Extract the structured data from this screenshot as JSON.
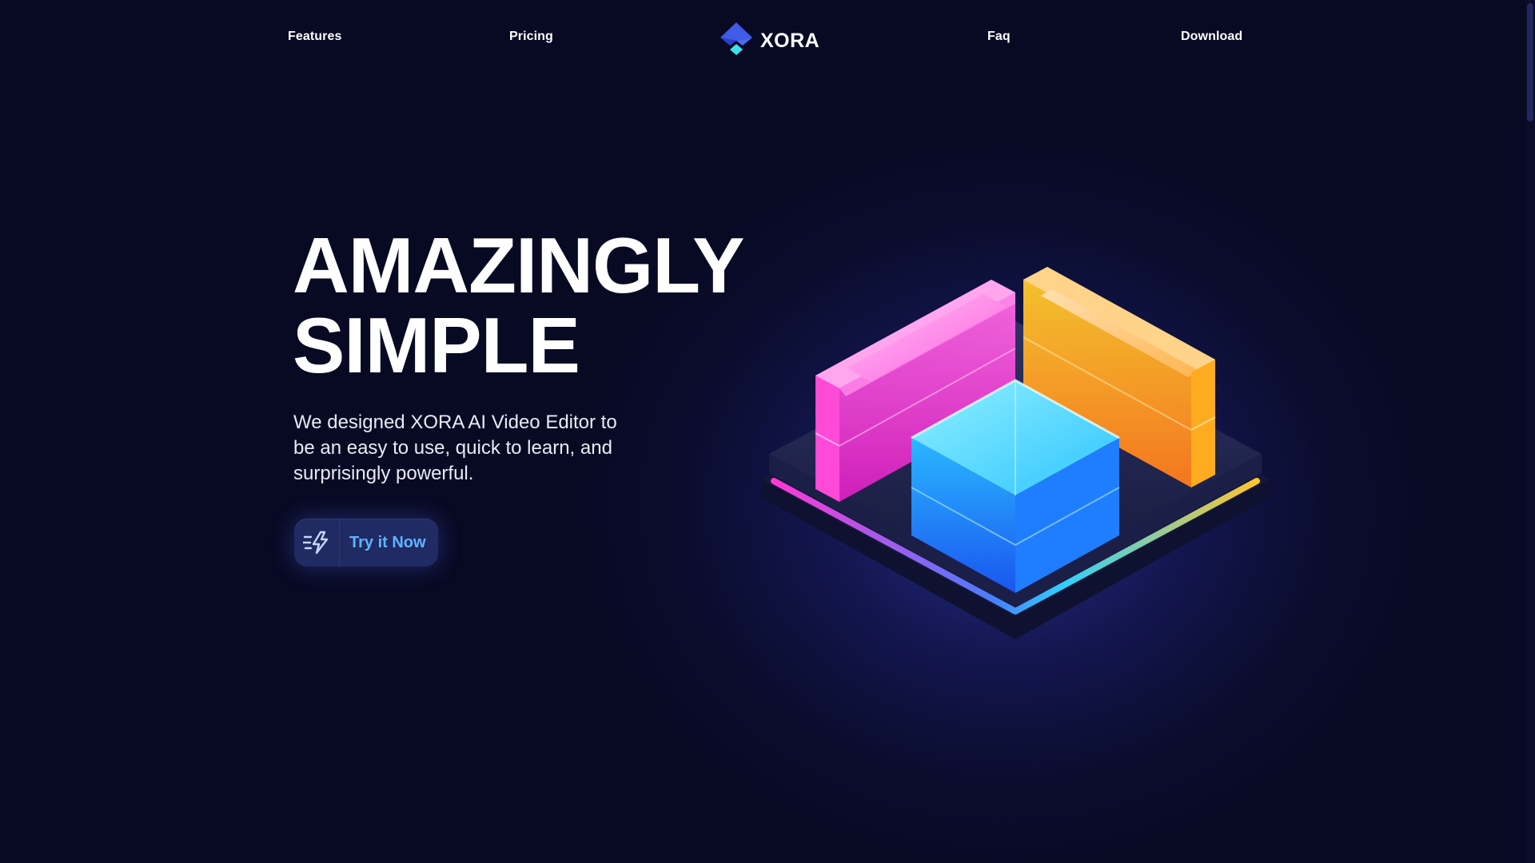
{
  "nav": {
    "links": [
      {
        "label": "Features"
      },
      {
        "label": "Pricing"
      },
      {
        "label": "Faq"
      },
      {
        "label": "Download"
      }
    ],
    "brand": "XORA"
  },
  "hero": {
    "title_line1": "AMAZINGLY",
    "title_line2": "SIMPLE",
    "subtitle": "We designed XORA AI Video Editor to be an easy to use, quick to learn, and surprisingly powerful.",
    "cta_label": "Try it Now"
  },
  "icons": {
    "logo": "diamond-logo-icon",
    "cta": "lightning-bolt-icon",
    "hero_art": "glowing-cube-blocks-illustration"
  },
  "colors": {
    "background": "#080a24",
    "cta_background": "#202a63",
    "cta_text": "#5fb4ff",
    "text": "#ffffff",
    "accent_magenta": "#ff3fd8",
    "accent_cyan": "#27c8ff",
    "accent_orange": "#ffb42a"
  }
}
